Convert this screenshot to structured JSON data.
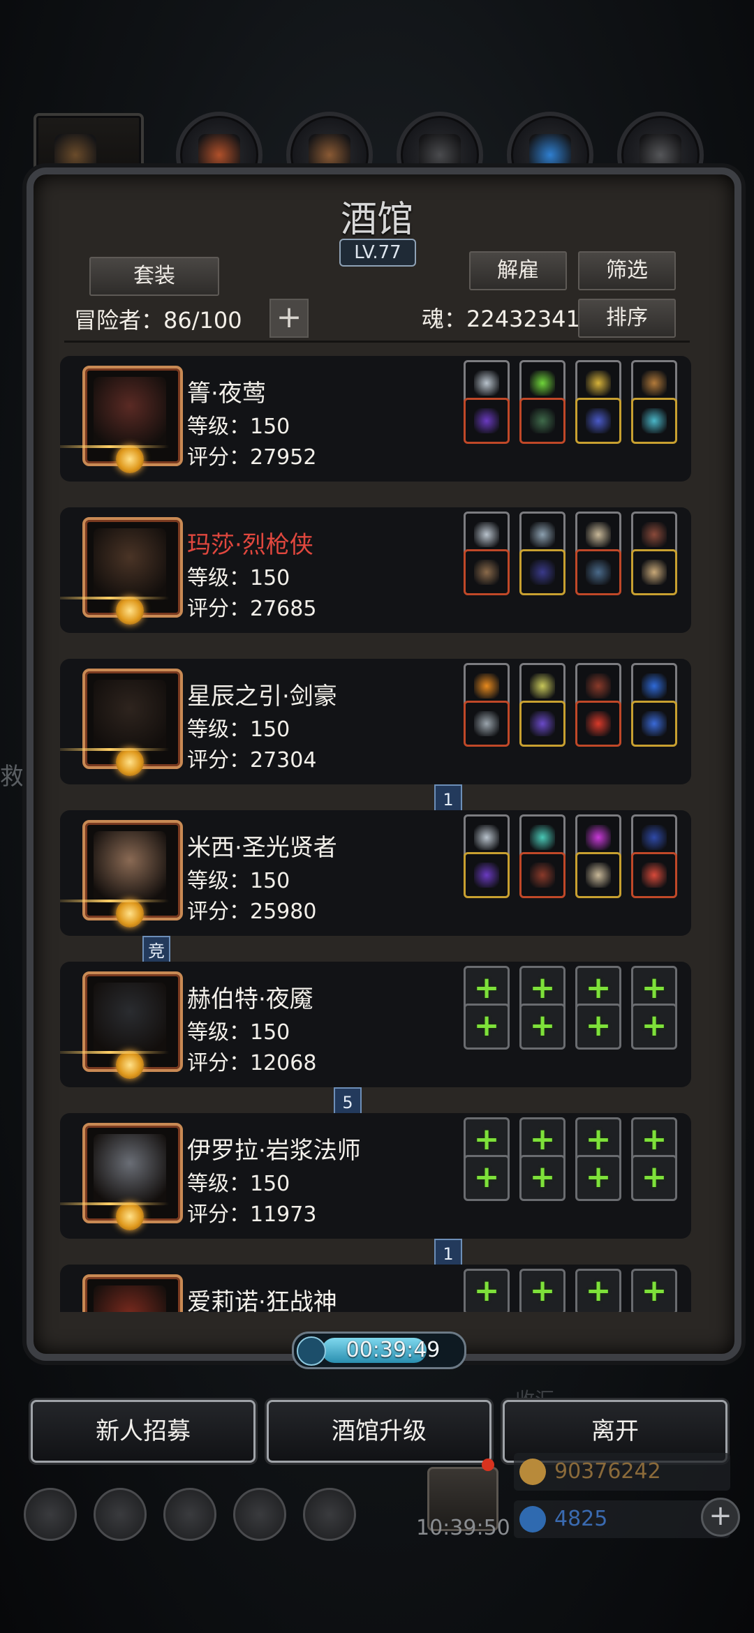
{
  "background": {
    "left_text": "救",
    "faded_label": "收汇"
  },
  "tabs": [
    {
      "icon": "tavern-icon",
      "color": "#6a4b2a"
    },
    {
      "icon": "mace-icon",
      "color": "#b0502a"
    },
    {
      "icon": "scroll-icon",
      "color": "#8a5a34"
    },
    {
      "icon": "stairs-icon",
      "color": "#4a4b4e"
    },
    {
      "icon": "wings-icon",
      "color": "#2f7fd0"
    },
    {
      "icon": "chest-icon",
      "color": "#555659"
    }
  ],
  "panel": {
    "title": "酒馆",
    "level": "LV.77",
    "set_button": "套装",
    "dismiss_button": "解雇",
    "filter_button": "筛选",
    "sort_button": "排序",
    "adventurers_label": "冒险者：86/100",
    "soul_label": "魂：22432341",
    "add_icon": "+"
  },
  "heroes": [
    {
      "name": "箐·夜莺",
      "name_color": "white",
      "level": "等级：150",
      "score": "评分：27952",
      "face": "#5a2a24",
      "slots": [
        {
          "icon": "ring-icon",
          "rarity": "normal",
          "color": "#b8c2cc"
        },
        {
          "icon": "potion-icon",
          "rarity": "normal",
          "color": "#6fd43a"
        },
        {
          "icon": "lantern-icon",
          "rarity": "normal",
          "color": "#d6b23a"
        },
        {
          "icon": "horn-icon",
          "rarity": "normal",
          "color": "#b27a3a"
        },
        {
          "icon": "staff-icon",
          "rarity": "red",
          "color": "#6a3ac0"
        },
        {
          "icon": "armor-icon",
          "rarity": "red",
          "color": "#3f6a4a"
        },
        {
          "icon": "mace-icon",
          "rarity": "gold",
          "color": "#4a5ac8"
        },
        {
          "icon": "amulet-icon",
          "rarity": "gold",
          "color": "#4ab6c8"
        }
      ]
    },
    {
      "name": "玛莎·烈枪侠",
      "name_color": "red",
      "level": "等级：150",
      "score": "评分：27685",
      "face": "#4a3426",
      "slots": [
        {
          "icon": "ring-icon",
          "rarity": "normal",
          "color": "#b8c2cc"
        },
        {
          "icon": "ore-icon",
          "rarity": "normal",
          "color": "#8ca0b0"
        },
        {
          "icon": "rod-icon",
          "rarity": "normal",
          "color": "#c8b898"
        },
        {
          "icon": "belt-icon",
          "rarity": "normal",
          "color": "#8a4a3a"
        },
        {
          "icon": "gun-icon",
          "rarity": "red",
          "color": "#8a6a4a"
        },
        {
          "icon": "cloak-icon",
          "rarity": "gold",
          "color": "#3a3a8a"
        },
        {
          "icon": "blade-icon",
          "rarity": "red",
          "color": "#4a6a8a"
        },
        {
          "icon": "shield-icon",
          "rarity": "gold",
          "color": "#c8a878"
        }
      ]
    },
    {
      "name": "星辰之引·剑豪",
      "name_color": "white",
      "level": "等级：150",
      "score": "评分：27304",
      "face": "#2e241e",
      "slots": [
        {
          "icon": "flame-ring-icon",
          "rarity": "normal",
          "color": "#e88a1e"
        },
        {
          "icon": "orb-icon",
          "rarity": "normal",
          "color": "#c8c85a"
        },
        {
          "icon": "antler-icon",
          "rarity": "normal",
          "color": "#8a3a2a"
        },
        {
          "icon": "feather-icon",
          "rarity": "normal",
          "color": "#2f6ad8"
        },
        {
          "icon": "sword-icon",
          "rarity": "red",
          "color": "#9aa4ac"
        },
        {
          "icon": "armor-icon",
          "rarity": "gold",
          "color": "#6a4ac8"
        },
        {
          "icon": "claw-icon",
          "rarity": "red",
          "color": "#d83a2a"
        },
        {
          "icon": "ring-icon",
          "rarity": "gold",
          "color": "#3a6ad8"
        }
      ],
      "badge": "1"
    },
    {
      "name": "米西·圣光贤者",
      "name_color": "white",
      "level": "等级：150",
      "score": "评分：25980",
      "face": "#8a6a54",
      "slots": [
        {
          "icon": "ring-icon",
          "rarity": "normal",
          "color": "#b8c2cc"
        },
        {
          "icon": "gem-icon",
          "rarity": "normal",
          "color": "#4ac8b6"
        },
        {
          "icon": "crystal-icon",
          "rarity": "normal",
          "color": "#c83ad8"
        },
        {
          "icon": "bow-icon",
          "rarity": "normal",
          "color": "#2f4aa8"
        },
        {
          "icon": "wand-icon",
          "rarity": "gold",
          "color": "#6a3ac0"
        },
        {
          "icon": "robe-icon",
          "rarity": "red",
          "color": "#8a3a2a"
        },
        {
          "icon": "pendant-icon",
          "rarity": "gold",
          "color": "#c8b898"
        },
        {
          "icon": "spear-icon",
          "rarity": "red",
          "color": "#d84a3a"
        }
      ],
      "badge": "竞"
    },
    {
      "name": "赫伯特·夜魇",
      "name_color": "white",
      "level": "等级：150",
      "score": "评分：12068",
      "face": "#2a2c30",
      "empty": true,
      "badge": "5"
    },
    {
      "name": "伊罗拉·岩浆法师",
      "name_color": "white",
      "level": "等级：150",
      "score": "评分：11973",
      "face": "#6a6e76",
      "empty": true,
      "badge": "1"
    },
    {
      "name": "爱莉诺·狂战神",
      "name_color": "white",
      "level": "",
      "score": "",
      "face": "#7a2a1e",
      "empty": true
    }
  ],
  "timer": "00:39:49",
  "bottom_buttons": {
    "recruit": "新人招募",
    "upgrade": "酒馆升级",
    "leave": "离开"
  },
  "hud": {
    "icons": [
      "settings-icon",
      "badge-icon",
      "scroll-icon",
      "mail-icon",
      "puzzle-icon"
    ],
    "gift_timer": "10:39:50",
    "gold": "90376242",
    "gems": "4825"
  }
}
